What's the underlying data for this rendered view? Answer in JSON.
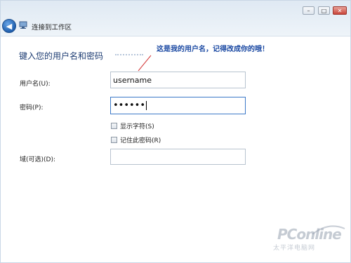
{
  "window": {
    "title": "连接到工作区",
    "controls": {
      "minimize": "–",
      "maximize": "□",
      "close": "✕"
    },
    "back_icon": "back-arrow-icon"
  },
  "form": {
    "heading": "键入您的用户名和密码",
    "annotation": "这是我的用户名，记得改成你的哦！",
    "username_label": "用户名(U):",
    "username_value": "username",
    "password_label": "密码(P):",
    "password_value": "••••••",
    "show_chars_label": "显示字符(S)",
    "remember_label": "记住此密码(R)",
    "domain_label": "域(可选)(D):",
    "domain_value": ""
  },
  "watermark": {
    "logo": "PConline",
    "sub": "太平洋电脑网"
  },
  "colors": {
    "heading": "#1e3d73",
    "annotation": "#1c4aa3",
    "focus_border": "#3b78c8"
  }
}
